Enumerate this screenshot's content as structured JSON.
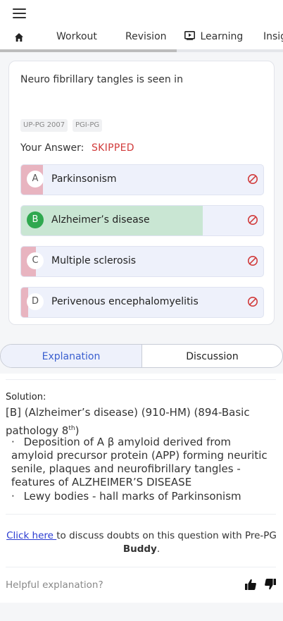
{
  "header": {
    "tabs": [
      {
        "label": "Workout"
      },
      {
        "label": "Revision"
      },
      {
        "label": "Learning"
      },
      {
        "label": "Insig"
      }
    ]
  },
  "question": {
    "text": "Neuro fibrillary tangles is seen in",
    "tags": [
      "UP-PG 2007",
      "PGI-PG"
    ],
    "your_answer_label": "Your Answer:",
    "your_answer_value": "SKIPPED",
    "options": [
      {
        "letter": "A",
        "text": "Parkinsonism",
        "response_fraction": 0.09,
        "correct": false
      },
      {
        "letter": "B",
        "text": "Alzheimer’s disease",
        "response_fraction": 0.75,
        "correct": true
      },
      {
        "letter": "C",
        "text": "Multiple sclerosis",
        "response_fraction": 0.06,
        "correct": false
      },
      {
        "letter": "D",
        "text": "Perivenous encephalomyelitis",
        "response_fraction": 0.03,
        "correct": false
      }
    ]
  },
  "segment": {
    "explanation_label": "Explanation",
    "discussion_label": "Discussion"
  },
  "solution": {
    "label": "Solution:",
    "reference_main": "[B] (Alzheimer’s disease) (910-HM) (894-Basic pathology 8",
    "reference_sup": "th",
    "reference_end": ")",
    "bullets": [
      "Deposition of A β amyloid derived from amyloid precursor protein (APP) forming neuritic senile, plaques and neurofibrillary tangles - features of ALZHEIMER’S DISEASE",
      "Lewy bodies - hall marks of Parkinsonism"
    ],
    "bullet_symbol": "·"
  },
  "discuss": {
    "link_text": "Click here ",
    "text_middle": "to discuss doubts on this question with Pre-PG ",
    "bold_text": "Buddy",
    "text_end": "."
  },
  "feedback": {
    "label": "Helpful explanation?"
  },
  "colors": {
    "accent_blue": "#3a5fcf",
    "skipped_red": "#d13b3b",
    "correct_green": "#c9e6d3",
    "wrong_pink": "#e8b4c0",
    "correct_badge": "#2fa84f"
  },
  "icons": {
    "menu": "hamburger-icon",
    "home": "home-icon",
    "learning": "play-screen-icon",
    "option_status": "ban-icon",
    "thumbs_up": "thumbs-up-icon",
    "thumbs_down": "thumbs-down-icon"
  }
}
